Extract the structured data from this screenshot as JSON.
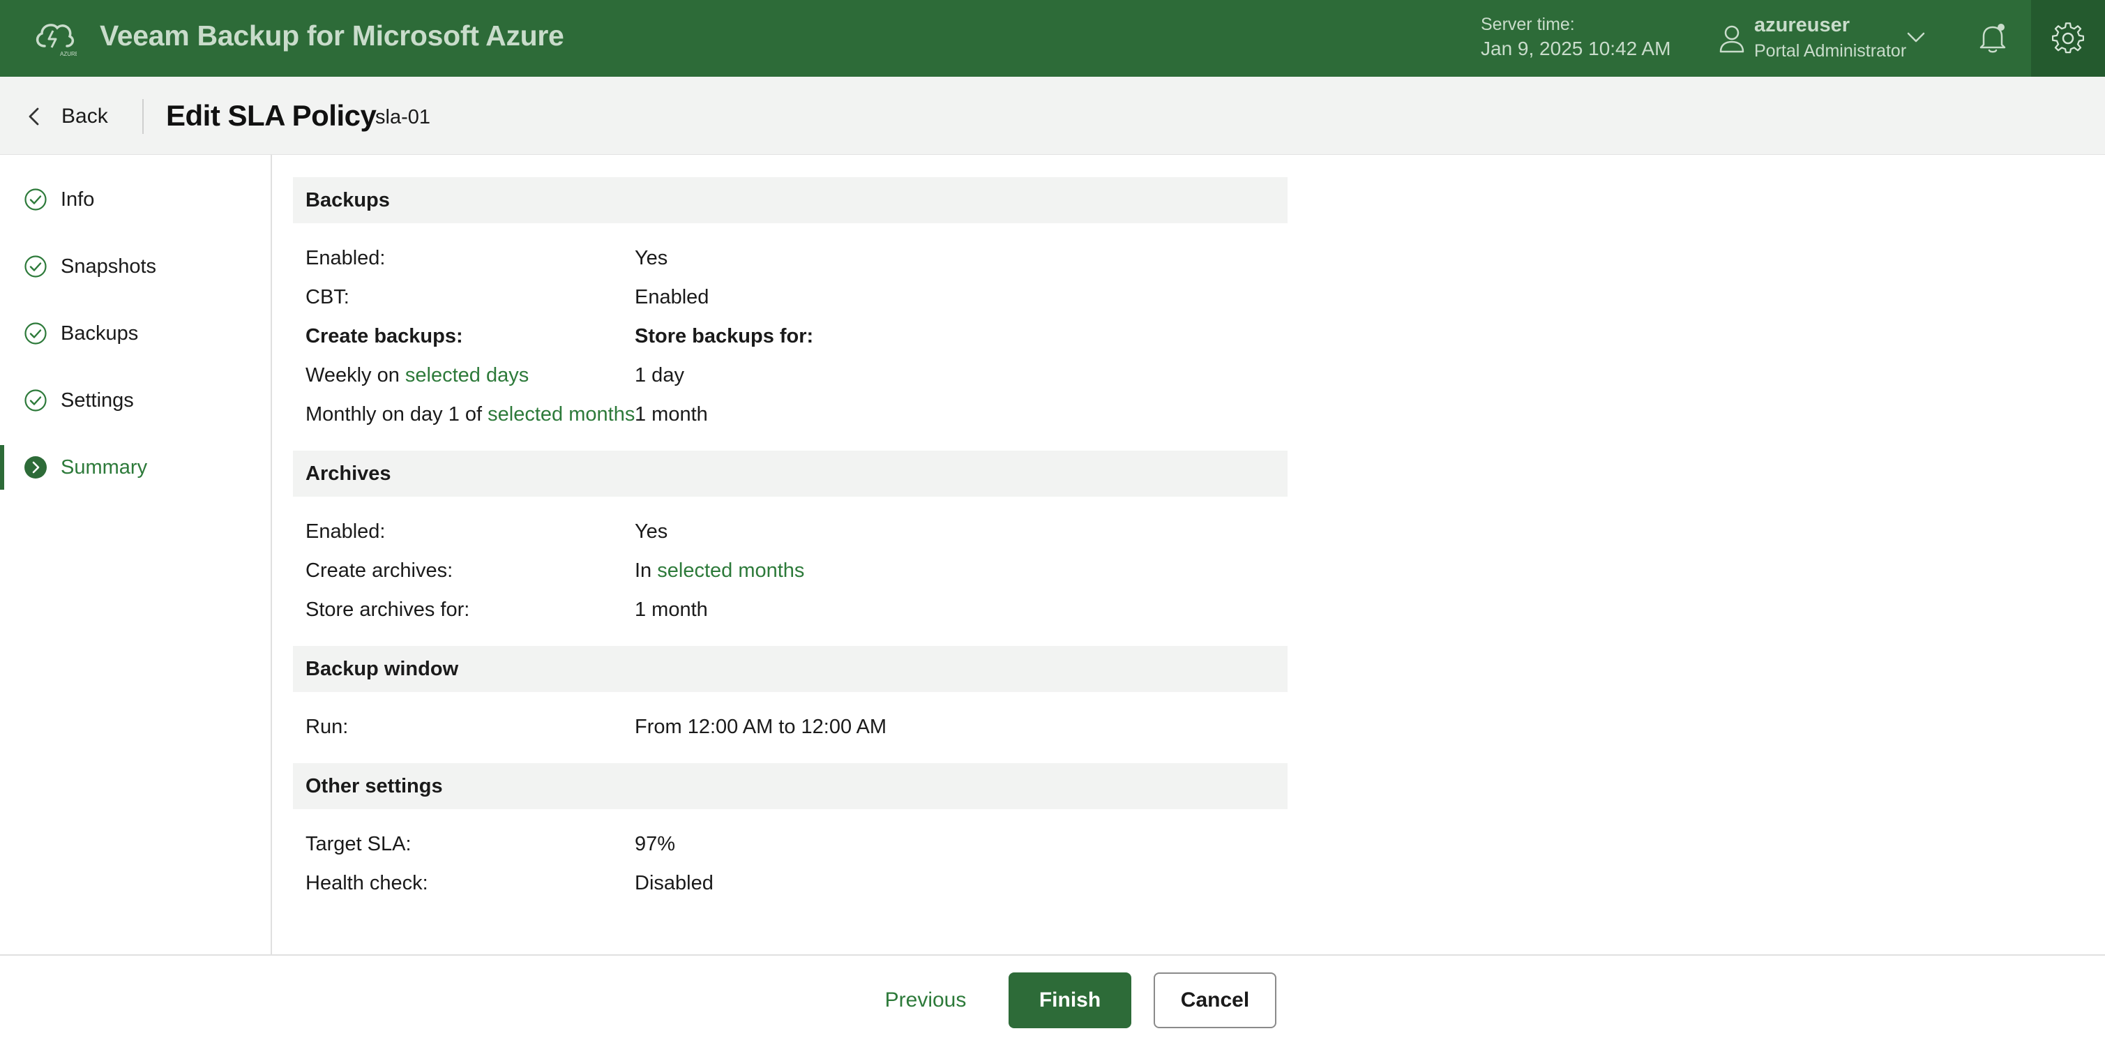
{
  "header": {
    "app_title": "Veeam Backup for Microsoft Azure",
    "logo_caption": "AZURE",
    "server_time_label": "Server time:",
    "server_time_value": "Jan 9, 2025 10:42 AM",
    "user_name": "azureuser",
    "user_role": "Portal Administrator"
  },
  "subheader": {
    "back_label": "Back",
    "page_title": "Edit SLA Policy",
    "policy_name": "sla-01"
  },
  "steps": [
    {
      "label": "Info",
      "status": "done"
    },
    {
      "label": "Snapshots",
      "status": "done"
    },
    {
      "label": "Backups",
      "status": "done"
    },
    {
      "label": "Settings",
      "status": "done"
    },
    {
      "label": "Summary",
      "status": "active"
    }
  ],
  "summary": {
    "backups": {
      "title": "Backups",
      "enabled_label": "Enabled:",
      "enabled_value": "Yes",
      "cbt_label": "CBT:",
      "cbt_value": "Enabled",
      "create_header": "Create backups:",
      "store_header": "Store backups for:",
      "weekly_prefix": "Weekly on ",
      "weekly_link": "selected days",
      "weekly_store": "1 day",
      "monthly_prefix": "Monthly on day 1 of ",
      "monthly_link": "selected months",
      "monthly_store": "1 month"
    },
    "archives": {
      "title": "Archives",
      "enabled_label": "Enabled:",
      "enabled_value": "Yes",
      "create_label": "Create archives:",
      "create_prefix": "In ",
      "create_link": "selected months",
      "store_label": "Store archives for:",
      "store_value": "1 month"
    },
    "backup_window": {
      "title": "Backup window",
      "run_label": "Run:",
      "run_value": "From 12:00 AM to 12:00 AM"
    },
    "other": {
      "title": "Other settings",
      "sla_label": "Target SLA:",
      "sla_value": "97%",
      "health_label": "Health check:",
      "health_value": "Disabled"
    }
  },
  "footer": {
    "previous_label": "Previous",
    "finish_label": "Finish",
    "cancel_label": "Cancel"
  },
  "colors": {
    "brand_green": "#2d6b38",
    "link_green": "#2d7a3a",
    "section_bg": "#f2f3f2"
  }
}
